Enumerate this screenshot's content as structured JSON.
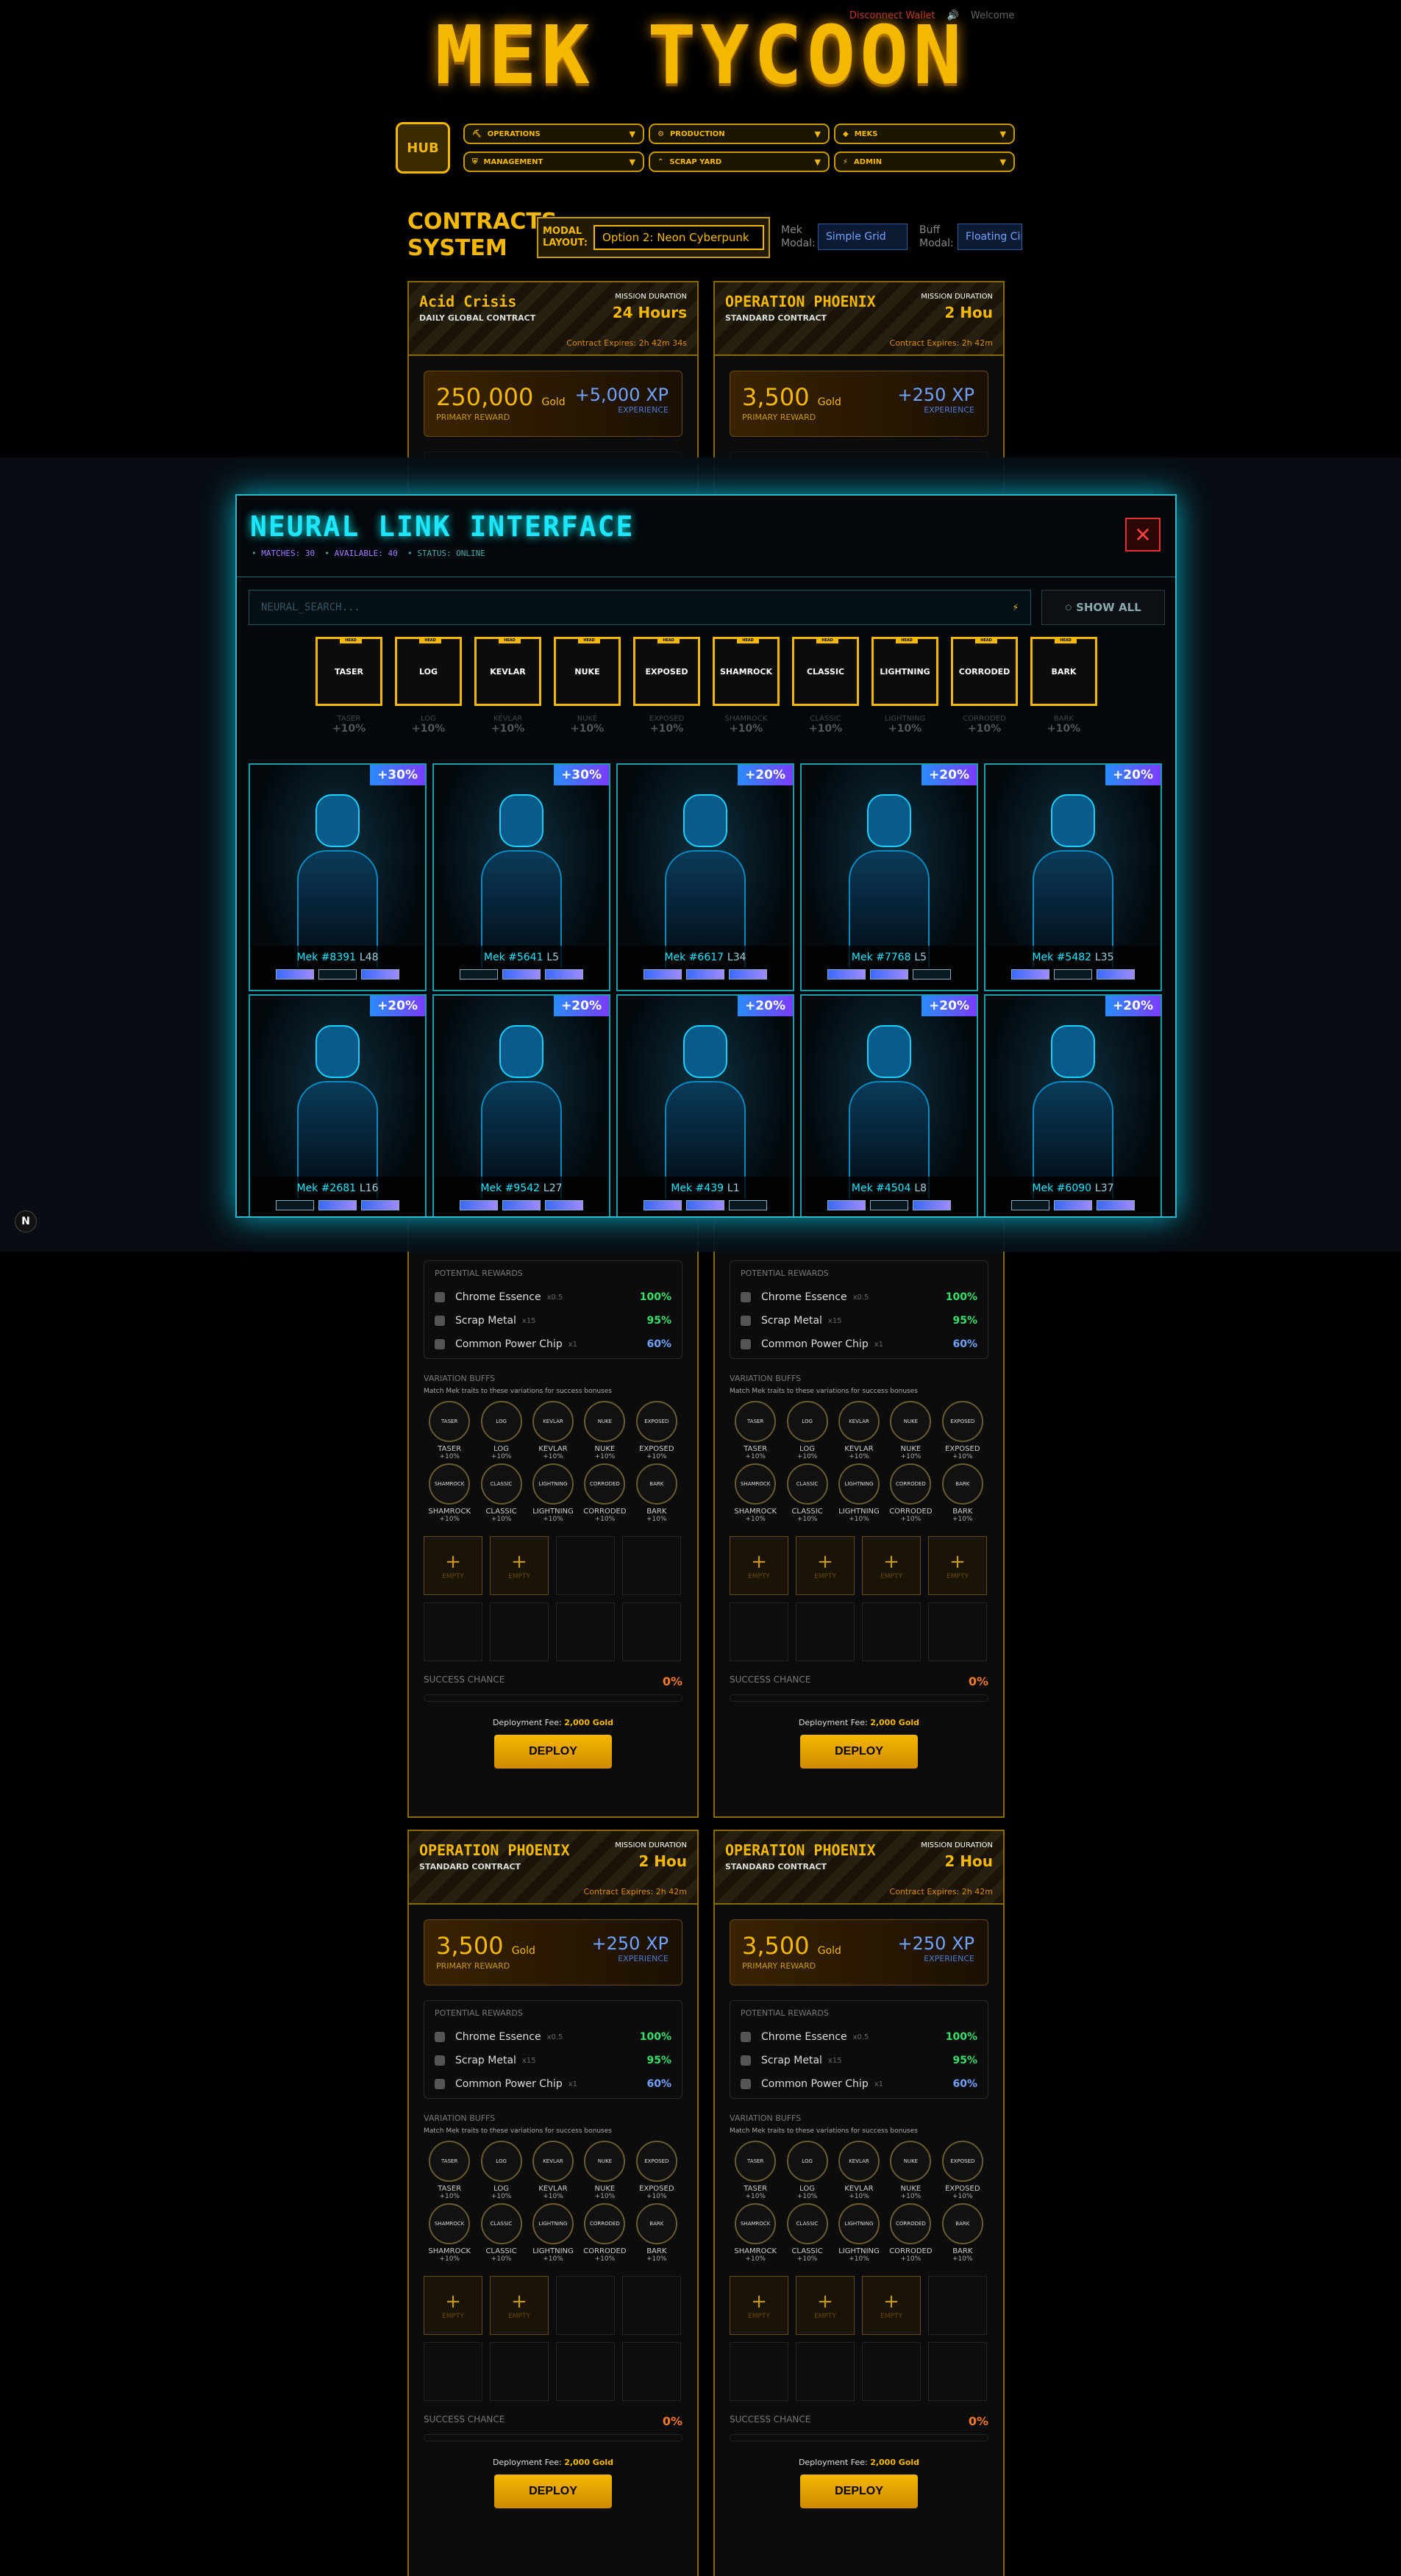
{
  "top": {
    "disconnect": "Disconnect Wallet",
    "welcome": "Welcome"
  },
  "logo": "MEK TYCOON",
  "nav": {
    "hub": "HUB",
    "items": [
      "OPERATIONS",
      "PRODUCTION",
      "MEKS",
      "MANAGEMENT",
      "SCRAP YARD",
      "ADMIN"
    ]
  },
  "contracts": {
    "title": "CONTRACTS SYSTEM",
    "layout_label": "MODAL LAYOUT:",
    "layout_value": "Option 2: Neon Cyberpunk",
    "mek_modal_label": "Mek Modal:",
    "mek_modal_value": "Simple Grid",
    "buff_modal_label": "Buff Modal:",
    "buff_modal_value": "Floating Cir"
  },
  "cards": [
    {
      "name": "Acid Crisis",
      "sub": "DAILY GLOBAL CONTRACT",
      "dur": "24 Hours",
      "exp": "Contract Expires: 2h 42m 34s",
      "gold": "250,000",
      "xp": "+5,000 XP",
      "slots": 2
    },
    {
      "name": "OPERATION PHOENIX",
      "sub": "STANDARD CONTRACT",
      "dur": "2 Hou",
      "exp": "Contract Expires: 2h 42m",
      "gold": "3,500",
      "xp": "+250 XP",
      "slots": 4
    },
    {
      "name": "OPERATION PHOENIX",
      "sub": "STANDARD CONTRACT",
      "dur": "2 Hou",
      "exp": "Contract Expires: 2h 42m",
      "gold": "3,500",
      "xp": "+250 XP",
      "slots": 2
    },
    {
      "name": "OPERATION PHOENIX",
      "sub": "STANDARD CONTRACT",
      "dur": "2 Hou",
      "exp": "Contract Expires: 2h 42m",
      "gold": "3,500",
      "xp": "+250 XP",
      "slots": 3
    }
  ],
  "card_common": {
    "md_label": "MISSION DURATION",
    "gold_unit": "Gold",
    "primary": "PRIMARY REWARD",
    "experience": "EXPERIENCE",
    "potential": "POTENTIAL REWARDS",
    "rewards": [
      {
        "name": "Chrome Essence",
        "qty": "x0.5",
        "pct": "100%",
        "color": "#3adf6a"
      },
      {
        "name": "Scrap Metal",
        "qty": "x15",
        "pct": "95%",
        "color": "#3adf6a"
      },
      {
        "name": "Common Power Chip",
        "qty": "x1",
        "pct": "60%",
        "color": "#6fa3ff"
      }
    ],
    "vb_title": "VARIATION BUFFS",
    "vb_sub": "Match Mek traits to these variations for success bonuses",
    "empty": "EMPTY",
    "success": "SUCCESS CHANCE",
    "success_val": "0%",
    "fee_label": "Deployment Fee:",
    "fee": "2,000 Gold",
    "deploy": "DEPLOY"
  },
  "variations": [
    "TASER",
    "LOG",
    "KEVLAR",
    "NUKE",
    "EXPOSED",
    "SHAMROCK",
    "CLASSIC",
    "LIGHTNING",
    "CORRODED",
    "BARK"
  ],
  "var_pct": "+10%",
  "var_tag": "HEAD",
  "modal": {
    "title": "NEURAL LINK INTERFACE",
    "matches": "MATCHES: 30",
    "available": "AVAILABLE: 40",
    "status": "STATUS: ONLINE",
    "search_placeholder": "NEURAL_SEARCH...",
    "show_all": "SHOW ALL",
    "meks": [
      {
        "name": "Mek #8391",
        "lvl": "L48",
        "buff": "+30%"
      },
      {
        "name": "Mek #5641",
        "lvl": "L5",
        "buff": "+30%"
      },
      {
        "name": "Mek #6617",
        "lvl": "L34",
        "buff": "+20%"
      },
      {
        "name": "Mek #7768",
        "lvl": "L5",
        "buff": "+20%"
      },
      {
        "name": "Mek #5482",
        "lvl": "L35",
        "buff": "+20%"
      },
      {
        "name": "Mek #2681",
        "lvl": "L16",
        "buff": "+20%"
      },
      {
        "name": "Mek #9542",
        "lvl": "L27",
        "buff": "+20%"
      },
      {
        "name": "Mek #439",
        "lvl": "L1",
        "buff": "+20%"
      },
      {
        "name": "Mek #4504",
        "lvl": "L8",
        "buff": "+20%"
      },
      {
        "name": "Mek #6090",
        "lvl": "L37",
        "buff": "+20%"
      }
    ]
  }
}
